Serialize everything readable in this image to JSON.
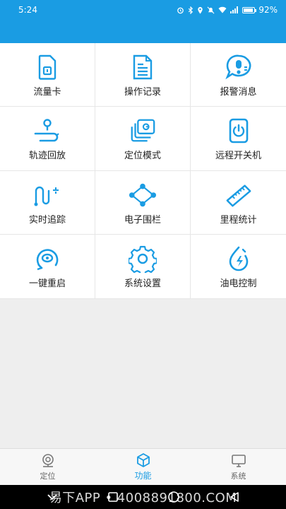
{
  "status_bar": {
    "time": "5:24",
    "battery_percent": "92%",
    "battery_level": 0.92,
    "icons": [
      "alarm-icon",
      "bluetooth-icon",
      "location-icon",
      "mute-icon",
      "wifi-icon",
      "signal-icon",
      "battery-icon"
    ]
  },
  "theme": {
    "accent": "#1a9ce3",
    "icon_color": "#1a9ce3",
    "background": "#eeeeee"
  },
  "grid": {
    "items": [
      {
        "label": "流量卡",
        "icon": "sim-card-icon"
      },
      {
        "label": "操作记录",
        "icon": "document-icon"
      },
      {
        "label": "报警消息",
        "icon": "alarm-message-icon"
      },
      {
        "label": "轨迹回放",
        "icon": "track-replay-icon"
      },
      {
        "label": "定位模式",
        "icon": "location-mode-icon"
      },
      {
        "label": "远程开关机",
        "icon": "power-icon"
      },
      {
        "label": "实时追踪",
        "icon": "realtime-track-icon"
      },
      {
        "label": "电子围栏",
        "icon": "geofence-icon"
      },
      {
        "label": "里程统计",
        "icon": "ruler-icon"
      },
      {
        "label": "一键重启",
        "icon": "restart-icon"
      },
      {
        "label": "系统设置",
        "icon": "gear-icon"
      },
      {
        "label": "油电控制",
        "icon": "fuel-electric-icon"
      }
    ]
  },
  "tabbar": {
    "tabs": [
      {
        "label": "定位",
        "icon": "location-pin-icon",
        "active": false
      },
      {
        "label": "功能",
        "icon": "cube-icon",
        "active": true
      },
      {
        "label": "系统",
        "icon": "monitor-icon",
        "active": false
      }
    ]
  },
  "navbar": {
    "watermark": "易下APP • 4008891800.COM"
  }
}
